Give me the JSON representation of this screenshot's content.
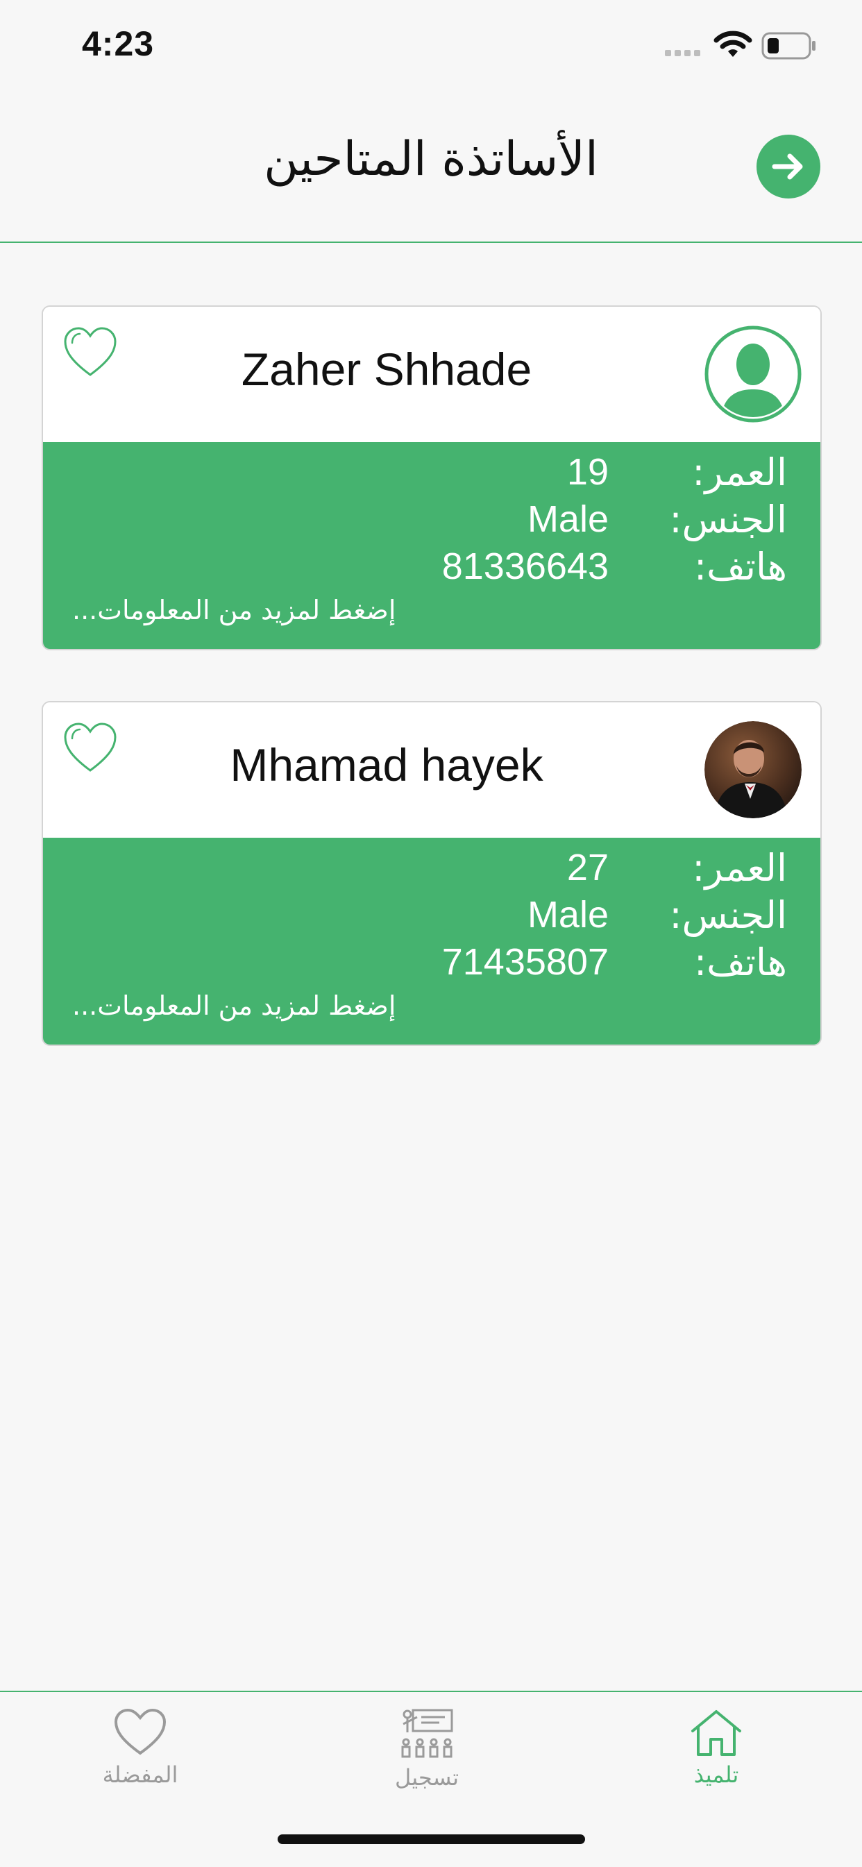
{
  "status_bar": {
    "time": "4:23",
    "icons": [
      "signal-icon",
      "wifi-icon",
      "battery-icon"
    ]
  },
  "header": {
    "title": "الأساتذة المتاحين",
    "back_icon": "arrow-right-icon"
  },
  "colors": {
    "accent": "#45b36f",
    "background": "#f7f7f7"
  },
  "teachers": [
    {
      "name": "Zaher Shhade",
      "avatar": "default-person-avatar",
      "age_label": "العمر:",
      "age": "19",
      "gender_label": "الجنس:",
      "gender": "Male",
      "phone_label": "هاتف:",
      "phone": "81336643",
      "more_text": "إضغط لمزيد من المعلومات..."
    },
    {
      "name": "Mhamad hayek",
      "avatar": "photo-avatar",
      "age_label": "العمر:",
      "age": "27",
      "gender_label": "الجنس:",
      "gender": "Male",
      "phone_label": "هاتف:",
      "phone": "71435807",
      "more_text": "إضغط لمزيد من المعلومات..."
    }
  ],
  "tabbar": {
    "tabs": [
      {
        "label": "المفضلة",
        "icon": "heart-icon",
        "active": false
      },
      {
        "label": "تسجيل",
        "icon": "classroom-icon",
        "active": false
      },
      {
        "label": "تلميذ",
        "icon": "home-icon",
        "active": true
      }
    ]
  }
}
